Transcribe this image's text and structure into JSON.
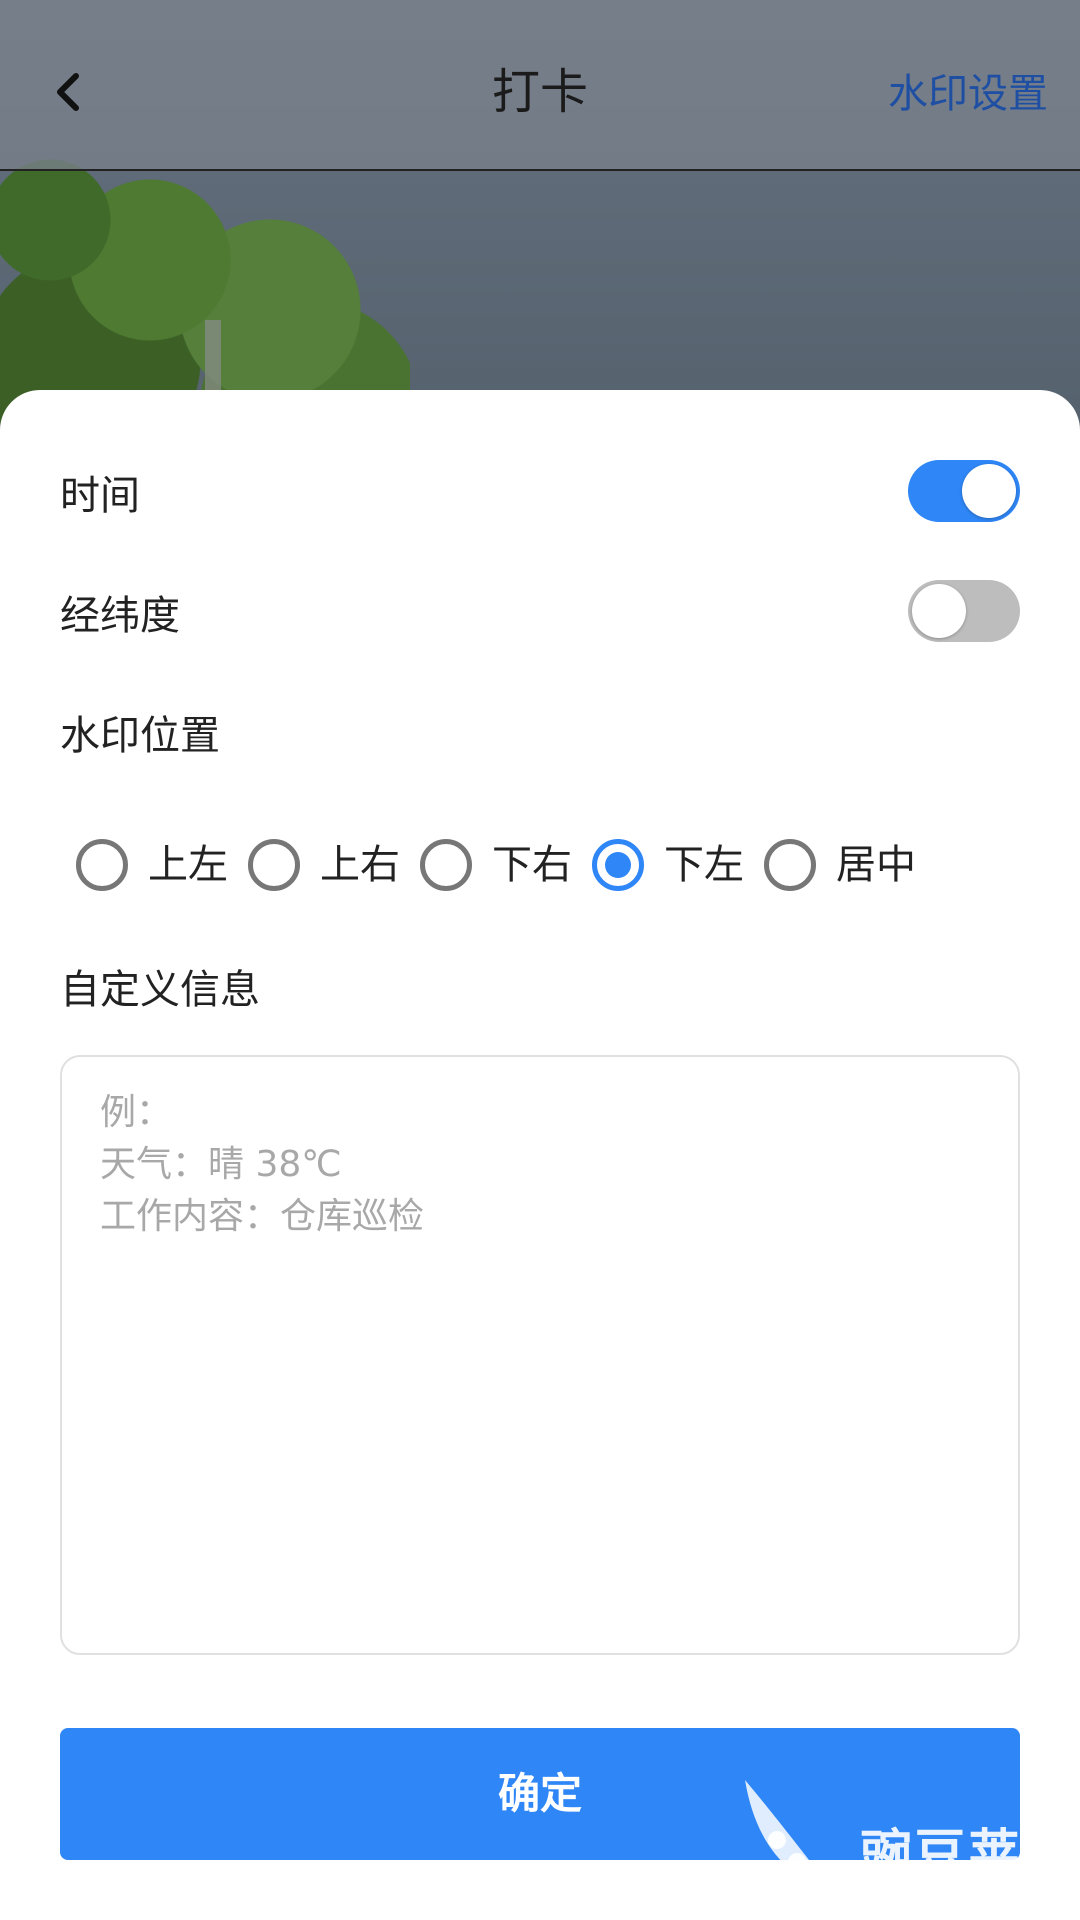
{
  "header": {
    "title": "打卡",
    "action_label": "水印设置"
  },
  "settings": {
    "time_label": "时间",
    "time_enabled": true,
    "coords_label": "经纬度",
    "coords_enabled": false,
    "position_label": "水印位置",
    "positions": [
      {
        "label": "上左",
        "checked": false
      },
      {
        "label": "上右",
        "checked": false
      },
      {
        "label": "下右",
        "checked": false
      },
      {
        "label": "下左",
        "checked": true
      },
      {
        "label": "居中",
        "checked": false
      }
    ],
    "custom_label": "自定义信息",
    "custom_placeholder_lines": [
      "例：",
      "天气：晴 38℃",
      "工作内容：仓库巡检"
    ]
  },
  "confirm_label": "确定",
  "watermark": {
    "brand": "豌豆荚"
  },
  "colors": {
    "accent": "#2f86f6",
    "header_action": "#1f4fa3",
    "switch_off": "#bdbdbd"
  }
}
